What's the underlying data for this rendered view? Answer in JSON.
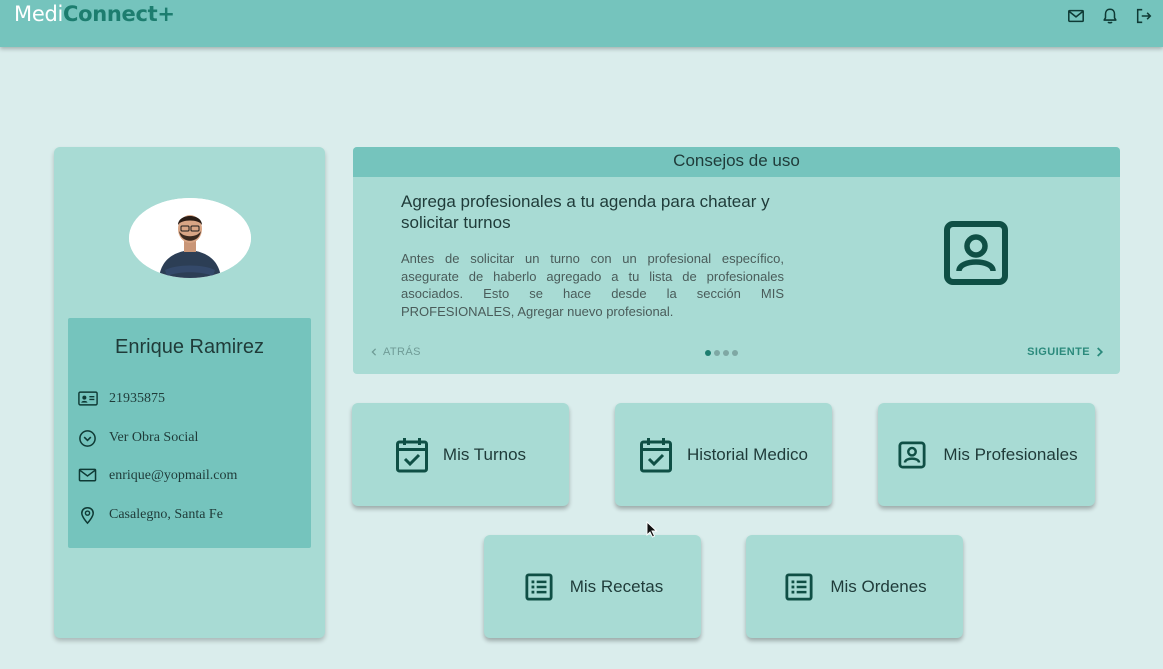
{
  "app": {
    "logo_part1": "Medi",
    "logo_part2": "Connect+",
    "header_icons": [
      "mail-icon",
      "bell-icon",
      "logout-icon"
    ]
  },
  "profile": {
    "name": "Enrique Ramirez",
    "fields": [
      {
        "icon": "id-card-icon",
        "text": "21935875"
      },
      {
        "icon": "chevron-circle-icon",
        "text": "Ver Obra Social"
      },
      {
        "icon": "mail-icon",
        "text": "enrique@yopmail.com"
      },
      {
        "icon": "location-pin-icon",
        "text": "Casalegno, Santa Fe"
      }
    ]
  },
  "tips": {
    "header": "Consejos de uso",
    "title": "Agrega profesionales a tu agenda para chatear y solicitar turnos",
    "body": "Antes de solicitar un turno con un profesional específico, asegurate de haberlo agregado a tu lista de profesionales asociados. Esto se hace desde la sección MIS PROFESIONALES, Agregar nuevo profesional.",
    "icon": "contact-portrait-icon",
    "prev_label": "ATRÁS",
    "next_label": "SIGUIENTE",
    "dots_total": 4,
    "dots_active_index": 0
  },
  "actions": [
    {
      "label": "Mis Turnos",
      "icon": "calendar-check-icon"
    },
    {
      "label": "Historial Medico",
      "icon": "calendar-check-icon"
    },
    {
      "label": "Mis Profesionales",
      "icon": "contact-portrait-icon"
    },
    {
      "label": "Mis Recetas",
      "icon": "list-icon"
    },
    {
      "label": "Mis Ordenes",
      "icon": "list-icon"
    }
  ],
  "colors": {
    "background": "#daedec",
    "header": "#75c4bd",
    "card": "#a8dbd4",
    "accent": "#1d7d6f",
    "icon": "#0f4f45"
  }
}
